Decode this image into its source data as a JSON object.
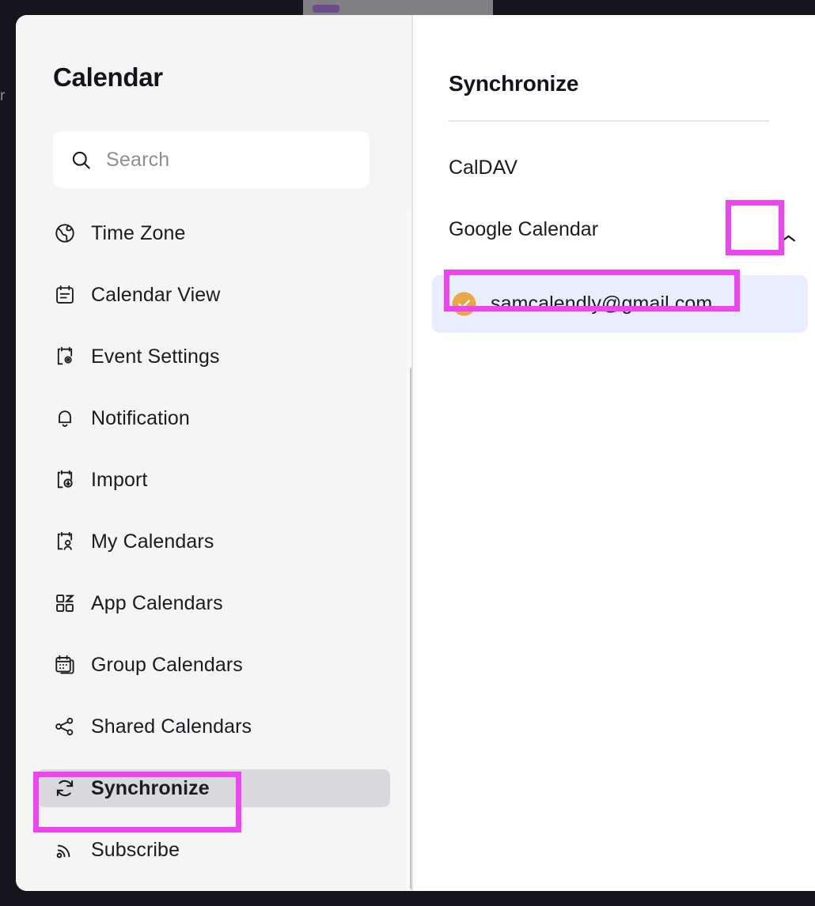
{
  "window": {
    "partial_left_text": "r"
  },
  "sidebar": {
    "title": "Calendar",
    "search": {
      "placeholder": "Search",
      "value": "",
      "icon": "search-icon"
    },
    "items": [
      {
        "label": "Time Zone",
        "icon": "globe-icon",
        "selected": false
      },
      {
        "label": "Calendar View",
        "icon": "calendar-list-icon",
        "selected": false
      },
      {
        "label": "Event Settings",
        "icon": "calendar-gear-icon",
        "selected": false
      },
      {
        "label": "Notification",
        "icon": "bell-icon",
        "selected": false
      },
      {
        "label": "Import",
        "icon": "calendar-download-icon",
        "selected": false
      },
      {
        "label": "My Calendars",
        "icon": "calendar-user-icon",
        "selected": false
      },
      {
        "label": "App Calendars",
        "icon": "apps-grid-icon",
        "selected": false
      },
      {
        "label": "Group Calendars",
        "icon": "calendar-stack-icon",
        "selected": false
      },
      {
        "label": "Shared Calendars",
        "icon": "share-nodes-icon",
        "selected": false
      },
      {
        "label": "Synchronize",
        "icon": "refresh-icon",
        "selected": true
      },
      {
        "label": "Subscribe",
        "icon": "rss-icon",
        "selected": false
      }
    ]
  },
  "detail": {
    "title": "Synchronize",
    "providers": [
      {
        "label": "CalDAV",
        "expandable": false
      },
      {
        "label": "Google Calendar",
        "expandable": true,
        "chevron": "chevron-up-icon"
      }
    ],
    "accounts": [
      {
        "email": "samcalendly@gmail.com",
        "status_icon": "check-circle-icon",
        "connected": true
      }
    ]
  },
  "colors": {
    "highlight": "#ef44f1",
    "selected_row": "#d9d9dd",
    "account_row": "#e9eefc",
    "check_circle": "#e8a944",
    "sidebar_bg": "#f5f5f6",
    "text": "#1b1b20"
  },
  "annotations": [
    {
      "target": "sidebar-item-synchronize",
      "color": "#ef44f1"
    },
    {
      "target": "google-calendar-collapse-button",
      "color": "#ef44f1"
    },
    {
      "target": "account-email-label",
      "color": "#ef44f1"
    }
  ]
}
